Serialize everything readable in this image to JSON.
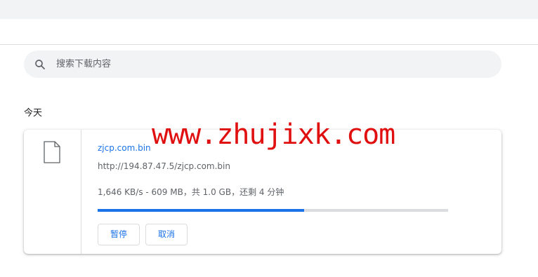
{
  "search": {
    "placeholder": "搜索下载内容",
    "icon": "search-icon"
  },
  "section": {
    "date_label": "今天"
  },
  "download": {
    "file_icon": "file-icon",
    "file_name": "zjcp.com.bin",
    "url": "http://194.87.47.5/zjcp.com.bin",
    "status": "1,646 KB/s - 609 MB，共 1.0 GB，还剩 4 分钟",
    "progress_fraction": 0.59,
    "buttons": {
      "pause": "暂停",
      "cancel": "取消"
    }
  },
  "watermark": {
    "text": "www.zhujixk.com"
  },
  "colors": {
    "accent": "#1a73e8",
    "watermark": "#e01010",
    "top_strip": "#f1f3f4"
  }
}
